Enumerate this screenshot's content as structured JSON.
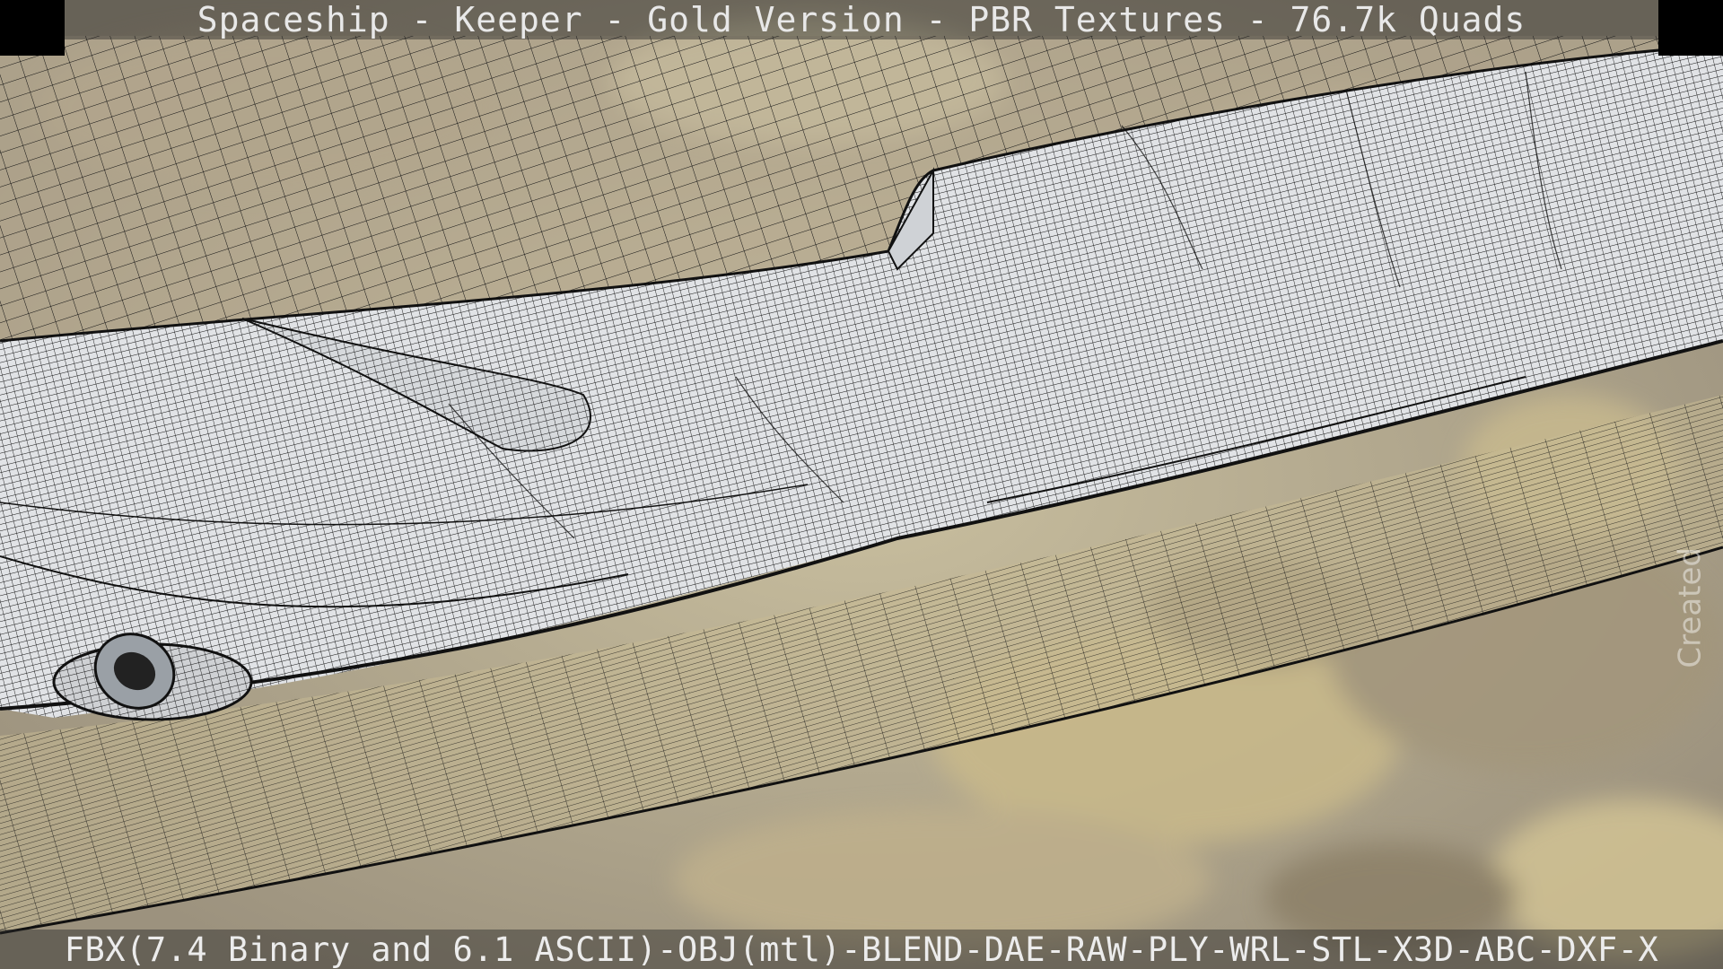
{
  "viewport": {
    "title": "Spaceship - Keeper - Gold Version - PBR Textures - 76.7k Quads",
    "formats": "FBX(7.4 Binary and 6.1 ASCII)-OBJ(mtl)-BLEND-DAE-RAW-PLY-WRL-STL-X3D-ABC-DXF-X",
    "watermark": "Created"
  },
  "colors": {
    "background_sand": "#b8ad98",
    "hull_fill": "#dfe2e5",
    "wire": "#111111",
    "bar_overlay": "rgba(40,40,40,0.45)"
  }
}
